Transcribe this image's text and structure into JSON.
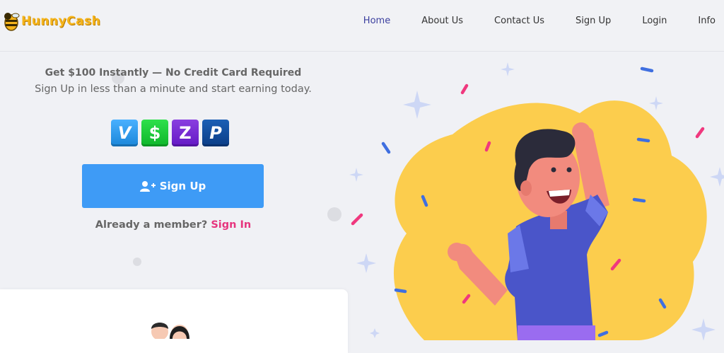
{
  "brand": {
    "name": "HunnyCash"
  },
  "nav": {
    "items": [
      {
        "label": "Home",
        "active": true
      },
      {
        "label": "About Us"
      },
      {
        "label": "Contact Us"
      },
      {
        "label": "Sign Up"
      },
      {
        "label": "Login"
      },
      {
        "label": "Info"
      }
    ]
  },
  "hero": {
    "headline": "Get $100 Instantly — No Credit Card Required",
    "subline": "Sign Up in less than a minute and start earning today.",
    "payment_methods": [
      "venmo-icon",
      "cash-app-icon",
      "zelle-icon",
      "paypal-icon"
    ],
    "signup_label": "Sign Up",
    "member_text": "Already a member?",
    "signin_label": "Sign In"
  },
  "colors": {
    "accent": "#3e9bf6",
    "link": "#e6357e",
    "nav_active": "#3b3f9e",
    "blob": "#fccd4d"
  }
}
